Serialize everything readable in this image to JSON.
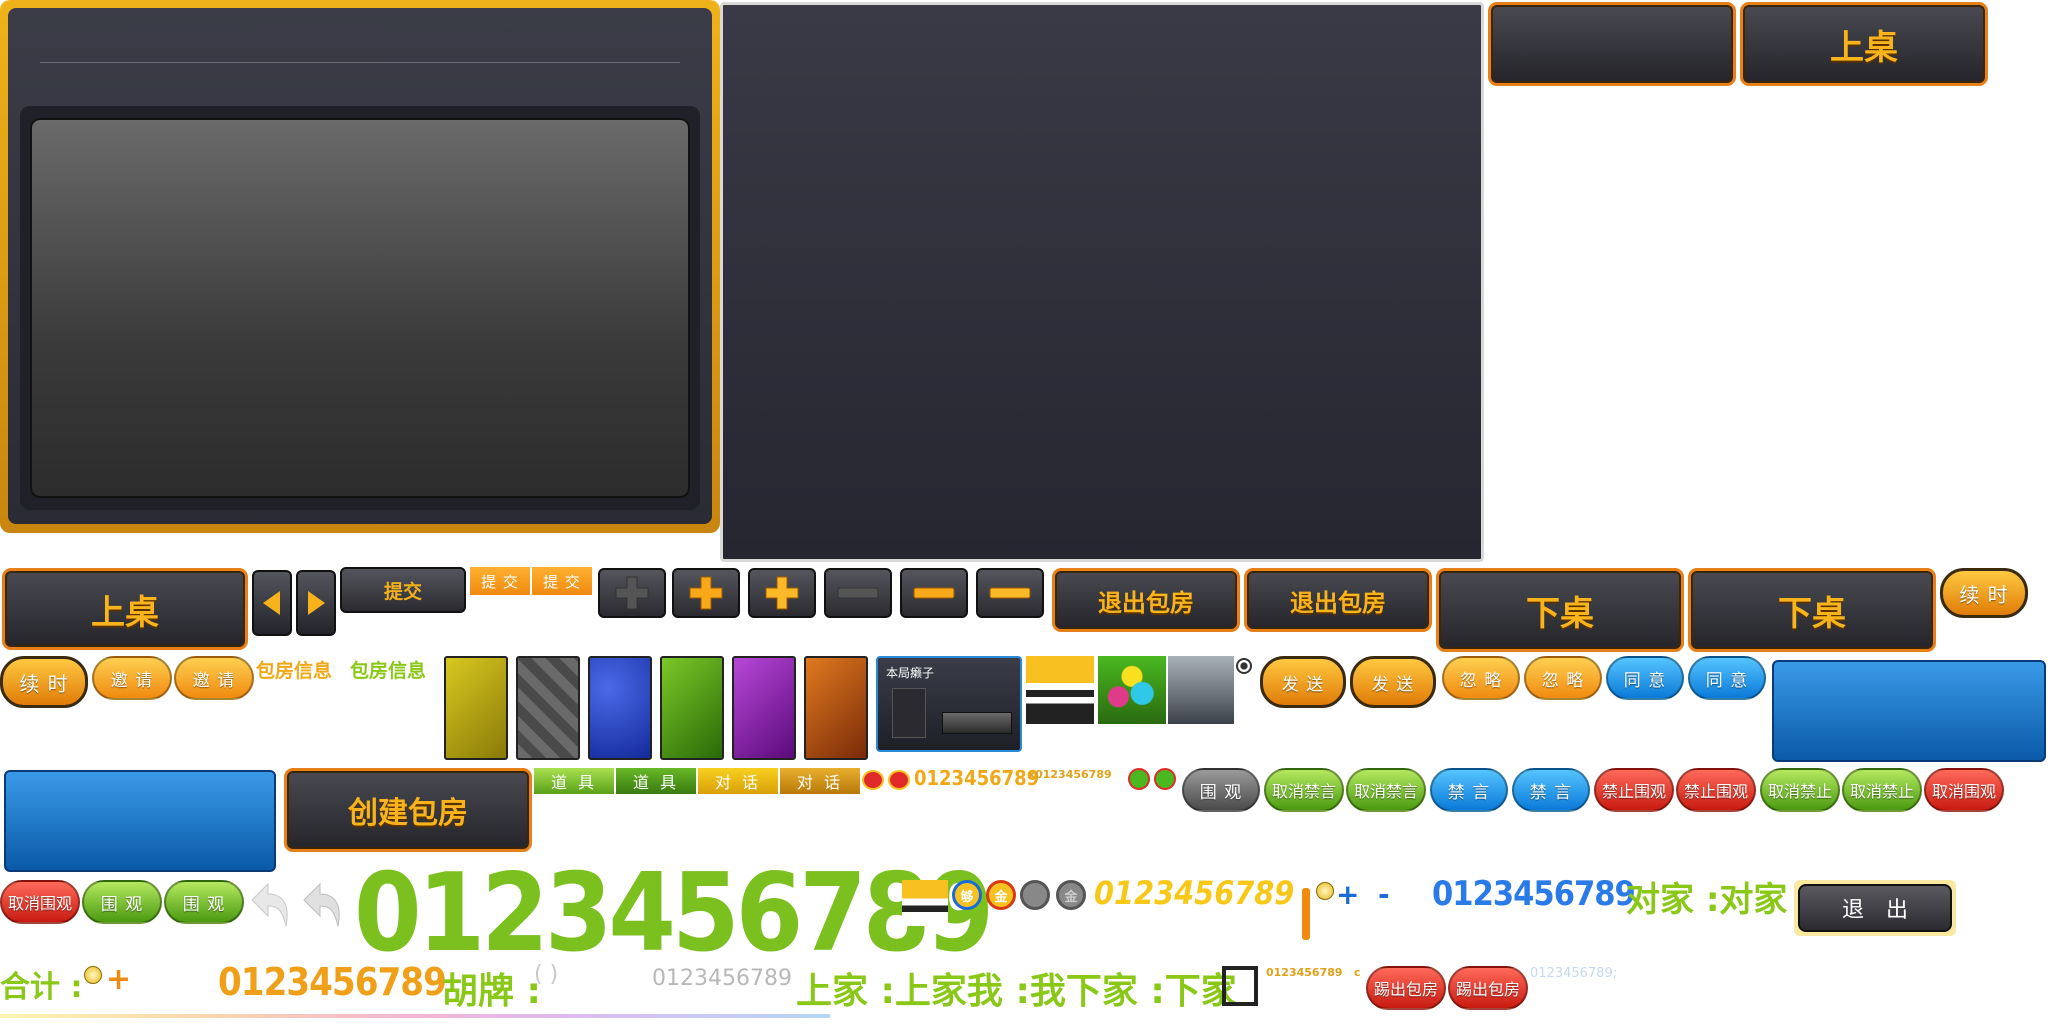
{
  "main_panel": {},
  "center_panel": {},
  "top_buttons": {
    "blank": "",
    "shangzhuo": "上桌"
  },
  "row2": {
    "shangzhuo": "上桌",
    "tijiao": "提交",
    "tijiao_a": "提 交",
    "tijiao_b": "提 交",
    "tuichu_a": "退出包房",
    "tuichu_b": "退出包房",
    "xiazhuo_a": "下桌",
    "xiazhuo_b": "下桌",
    "xushi": "续 时"
  },
  "row3": {
    "xushi": "续 时",
    "yaoqing_a": "邀 请",
    "yaoqing_b": "邀 请",
    "baofang_info_a": "包房信息",
    "baofang_info_b": "包房信息",
    "laizi_label": "本局癞子",
    "fasong_a": "发 送",
    "fasong_b": "发 送",
    "hulue_a": "忽 略",
    "hulue_b": "忽 略",
    "tongyi_a": "同 意",
    "tongyi_b": "同 意"
  },
  "row4": {
    "chuangjian": "创建包房",
    "daoju_a": "道 具",
    "daoju_b": "道 具",
    "duihua_a": "对 话",
    "duihua_b": "对 话",
    "digits_gold": "0123456789",
    "digits_small": "x0123456789",
    "weiguan": "围 观",
    "quxiao_jinyan_a": "取消禁言",
    "quxiao_jinyan_b": "取消禁言",
    "jinyan_a": "禁 言",
    "jinyan_b": "禁 言",
    "jinzhi_weiguan_a": "禁止围观",
    "jinzhi_weiguan_b": "禁止围观",
    "quxiao_jinzhi_a": "取消禁止",
    "quxiao_jinzhi_b": "取消禁止",
    "quxiao_weiguan": "取消围观"
  },
  "row5": {
    "quxiao_weiguan": "取消围观",
    "weiguan_a": "围 观",
    "weiguan_b": "围 观",
    "big_digits": "0123456789",
    "coin_gou": "够",
    "coin_jin": "金",
    "digits_yellow": "0123456789",
    "plus": "+",
    "minus": "-",
    "digits_blue": "0123456789",
    "duijia": "对家 :对家",
    "tuichu": "退　出"
  },
  "row6": {
    "heji": "合计 :",
    "plus": "+",
    "digits_orange": "0123456789",
    "hupai": "胡牌 :",
    "paren": "( )",
    "digits_gray": "0123456789",
    "labels_green": "上家 :上家我 :我下家 :下家",
    "tiny_digits": "0123456789",
    "tiny_c": "c",
    "tichu_a": "踢出包房",
    "tichu_b": "踢出包房",
    "digits_faint": "0123456789;"
  }
}
